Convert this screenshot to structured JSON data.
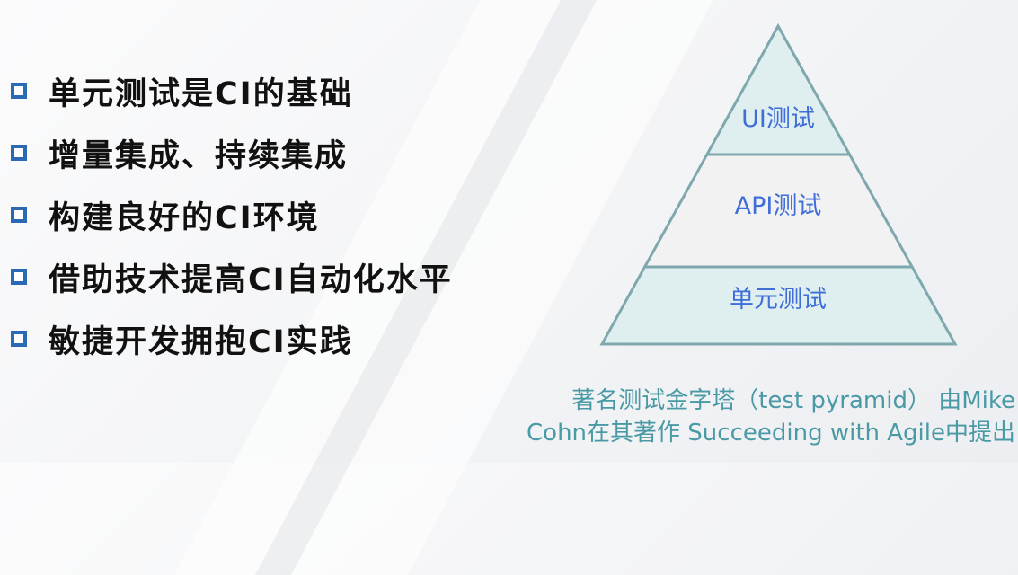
{
  "bullets": [
    {
      "text": "单元测试是CI的基础"
    },
    {
      "text": "增量集成、持续集成"
    },
    {
      "text": "构建良好的CI环境"
    },
    {
      "text": "借助技术提高CI自动化水平"
    },
    {
      "text": "敏捷开发拥抱CI实践"
    }
  ],
  "pyramid": {
    "layers": [
      {
        "label": "UI测试",
        "fill": "#dfefef"
      },
      {
        "label": "API测试",
        "fill": "#f2f2f2"
      },
      {
        "label": "单元测试",
        "fill": "#dfefef"
      }
    ],
    "outline_color": "#7ea8ae"
  },
  "caption": {
    "line1": "著名测试金字塔（test pyramid） 由Mike",
    "line2": "Cohn在其著作 Succeeding with Agile中提出"
  },
  "colors": {
    "bullet_marker": "#2a6ab5",
    "layer_text": "#3f6ed8",
    "caption_text": "#4a9aa6"
  }
}
